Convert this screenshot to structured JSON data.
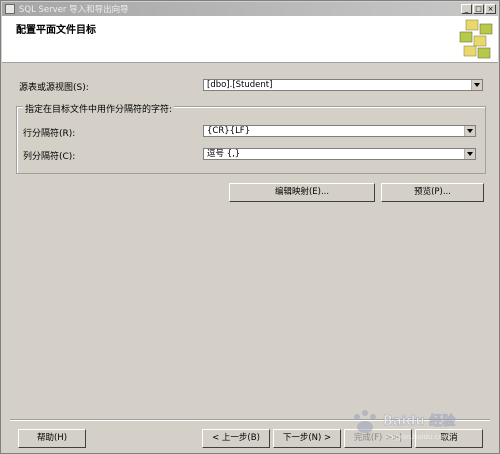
{
  "window": {
    "title": "SQL Server 导入和导出向导",
    "controls": [
      "_",
      "□",
      "×"
    ]
  },
  "header": {
    "title": "配置平面文件目标"
  },
  "source": {
    "label": "源表或源视图(S):",
    "value": "[dbo].[Student]"
  },
  "delimiters": {
    "group_label": "指定在目标文件中用作分隔符的字符:",
    "row": {
      "label": "行分隔符(R):",
      "value": "{CR}{LF}"
    },
    "column": {
      "label": "列分隔符(C):",
      "value": "逗号 {,}"
    }
  },
  "actions": {
    "edit_mappings": "编辑映射(E)...",
    "preview": "预览(P)..."
  },
  "footer": {
    "help": "帮助(H)",
    "back": "< 上一步(B)",
    "next": "下一步(N) >",
    "finish": "完成(F) >>|",
    "cancel": "取消"
  },
  "watermark": {
    "text": "Baidu 经验",
    "url": "jingyan.baidu.com"
  },
  "colors": {
    "window_bg": "#d4d0c8",
    "header_bg": "#ffffff",
    "logo_green": "#b7c84a",
    "logo_yellow": "#e8d96a"
  }
}
